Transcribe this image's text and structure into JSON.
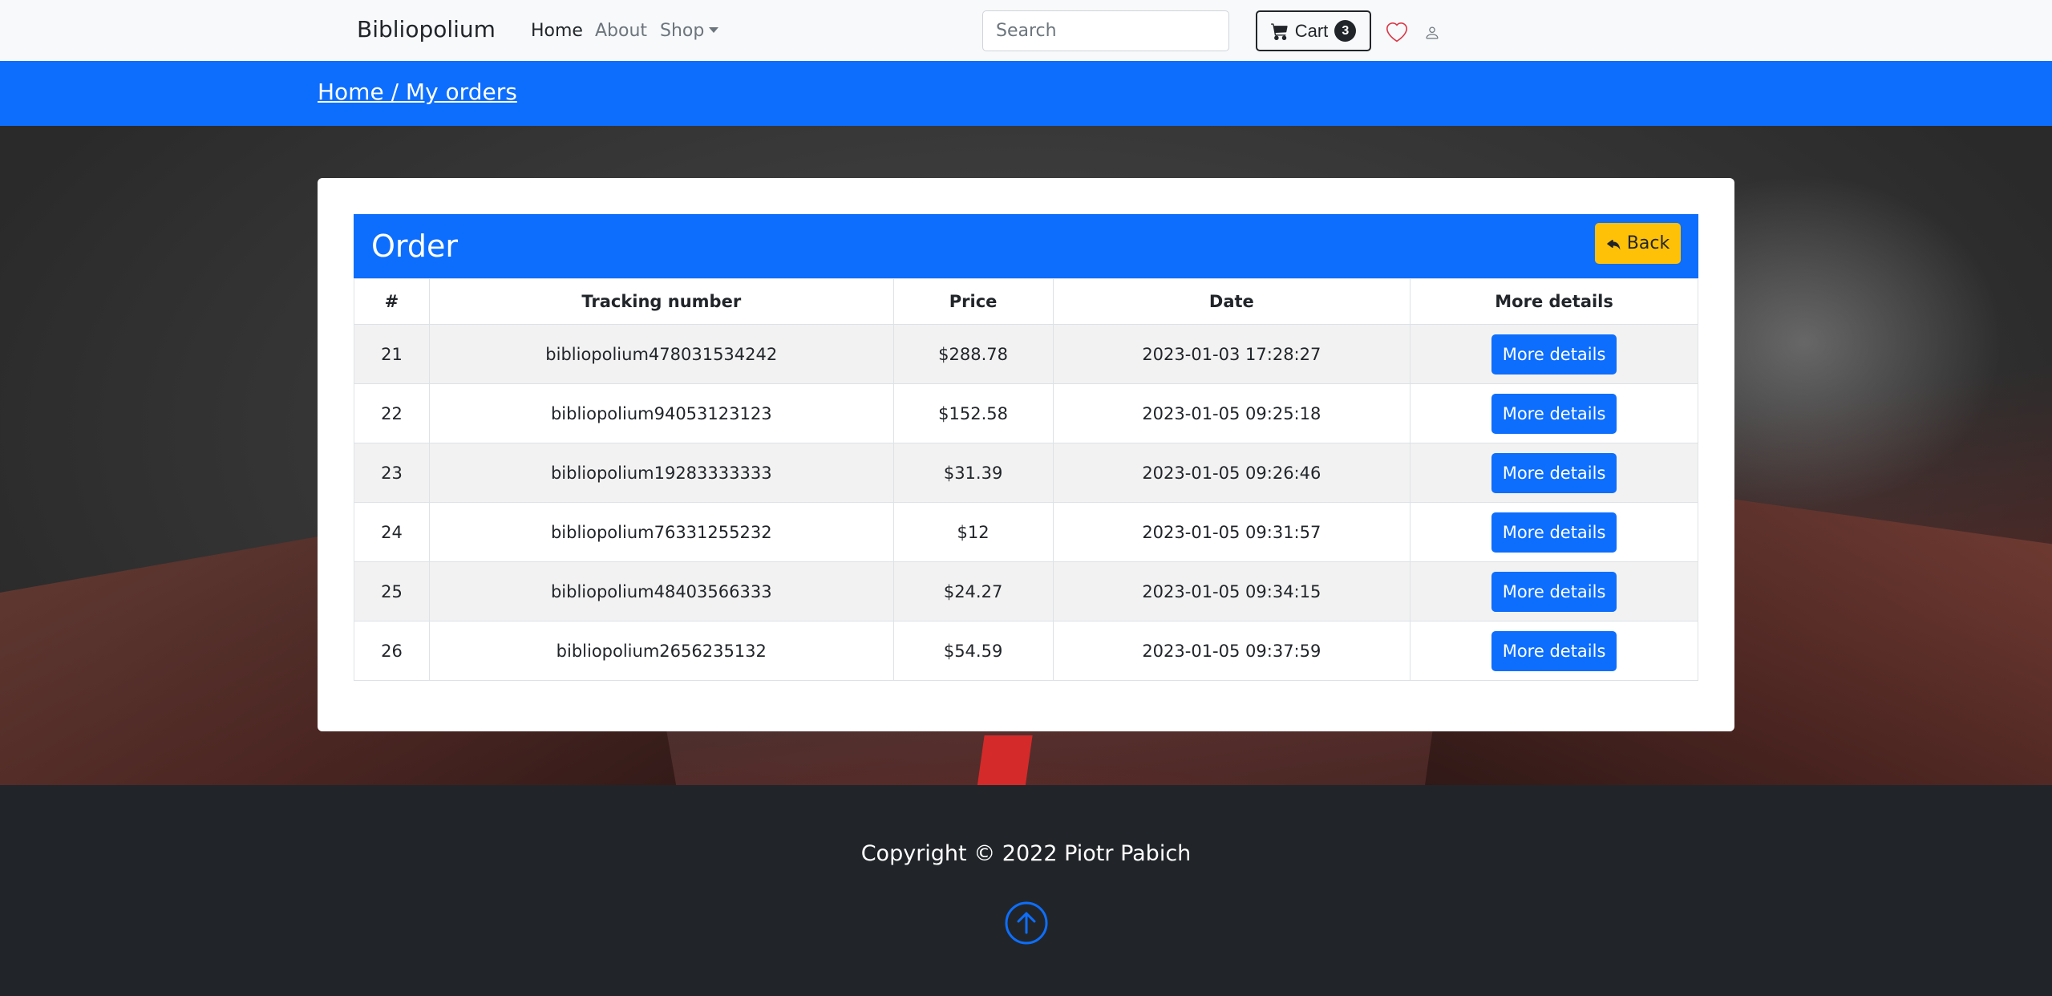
{
  "navbar": {
    "brand": "Bibliopolium",
    "links": [
      {
        "label": "Home",
        "active": true
      },
      {
        "label": "About",
        "active": false
      },
      {
        "label": "Shop",
        "active": false
      }
    ],
    "search_placeholder": "Search",
    "cart_label": "Cart",
    "cart_count": "3",
    "icons": [
      "cart-icon",
      "heart-icon",
      "user-icon"
    ]
  },
  "breadcrumb": "Home / My orders",
  "card": {
    "title": "Order",
    "back_label": "Back",
    "columns": [
      "#",
      "Tracking number",
      "Price",
      "Date",
      "More details"
    ],
    "rows": [
      {
        "id": "21",
        "tracking": "bibliopolium478031534242",
        "price": "$288.78",
        "date": "2023-01-03 17:28:27",
        "action": "More details"
      },
      {
        "id": "22",
        "tracking": "bibliopolium94053123123",
        "price": "$152.58",
        "date": "2023-01-05 09:25:18",
        "action": "More details"
      },
      {
        "id": "23",
        "tracking": "bibliopolium19283333333",
        "price": "$31.39",
        "date": "2023-01-05 09:26:46",
        "action": "More details"
      },
      {
        "id": "24",
        "tracking": "bibliopolium76331255232",
        "price": "$12",
        "date": "2023-01-05 09:31:57",
        "action": "More details"
      },
      {
        "id": "25",
        "tracking": "bibliopolium48403566333",
        "price": "$24.27",
        "date": "2023-01-05 09:34:15",
        "action": "More details"
      },
      {
        "id": "26",
        "tracking": "bibliopolium2656235132",
        "price": "$54.59",
        "date": "2023-01-05 09:37:59",
        "action": "More details"
      }
    ]
  },
  "footer": {
    "copyright": "Copyright © 2022 Piotr Pabich",
    "scroll_top_icon": "arrow-up-circle-icon"
  },
  "colors": {
    "primary": "#0d6efd",
    "warning": "#ffc107",
    "dark": "#212529",
    "heart": "#dc3545"
  }
}
